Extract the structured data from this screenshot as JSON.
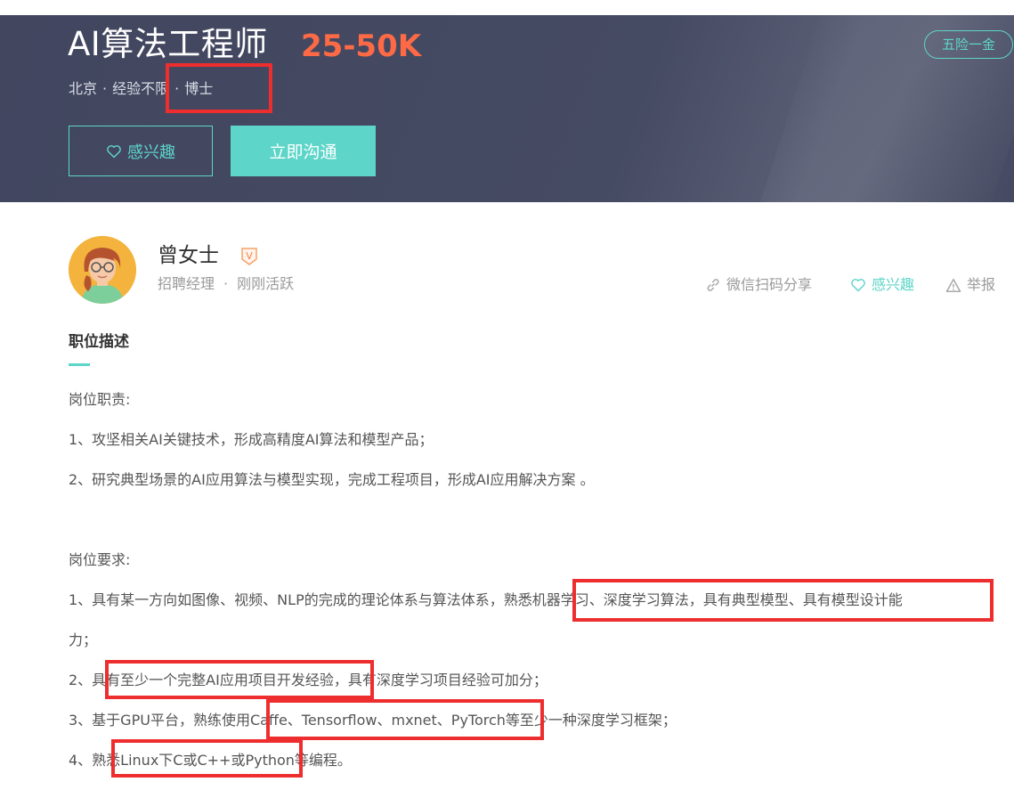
{
  "job": {
    "title": "AI算法工程师",
    "salary": "25-50K",
    "city": "北京",
    "experience": "经验不限",
    "degree": "博士",
    "separator": "·",
    "welfare": "五险一金",
    "interest_button": "感兴趣",
    "chat_button": "立即沟通"
  },
  "recruiter": {
    "name": "曾女士",
    "verified_mark": "V",
    "role": "招聘经理",
    "separator": "·",
    "status": "刚刚活跃"
  },
  "actions": {
    "share": "微信扫码分享",
    "interest": "感兴趣",
    "report": "举报"
  },
  "description": {
    "title": "职位描述",
    "lines": [
      "岗位职责:",
      "1、攻坚相关AI关键技术，形成高精度AI算法和模型产品；",
      "2、研究典型场景的AI应用算法与模型实现，完成工程项目，形成AI应用解决方案 。",
      "岗位要求:",
      "1、具有某一方向如图像、视频、NLP的完成的理论体系与算法体系，熟悉机器学习、深度学习算法，具有典型模型、具有模型设计能",
      "力；",
      "2、具有至少一个完整AI应用项目开发经验，具有深度学习项目经验可加分；",
      "3、基于GPU平台，熟练使用Caffe、Tensorflow、mxnet、PyTorch等至少一种深度学习框架；",
      "4、熟悉Linux下C或C++或Python等编程。"
    ]
  },
  "colors": {
    "accent": "#5dd5c8",
    "salary": "#fd6a45",
    "header_bg": "#454b63",
    "highlight": "#ee2e2e"
  },
  "icons": [
    "heart-icon",
    "link-icon",
    "warning-icon",
    "verified-icon"
  ]
}
